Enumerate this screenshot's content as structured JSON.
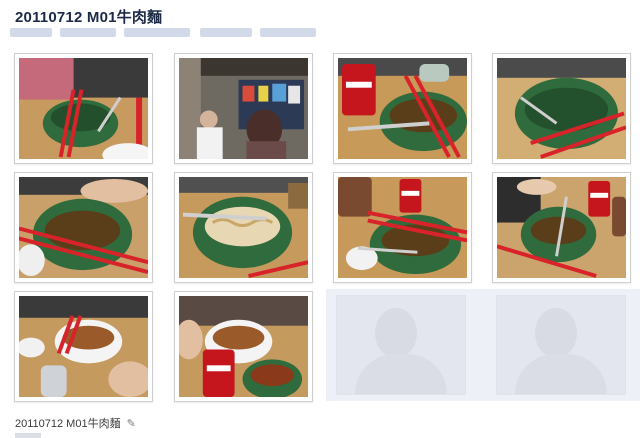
{
  "album": {
    "title": "20110712 M01牛肉麵"
  },
  "photos": [
    {
      "name": "photo-1",
      "alt": "bowl with chopsticks"
    },
    {
      "name": "photo-2",
      "alt": "restaurant interior"
    },
    {
      "name": "photo-3",
      "alt": "coca-cola and bowl"
    },
    {
      "name": "photo-4",
      "alt": "empty bowl"
    },
    {
      "name": "photo-5",
      "alt": "bowl with chopsticks"
    },
    {
      "name": "photo-6",
      "alt": "noodle bowl"
    },
    {
      "name": "photo-7",
      "alt": "bowl and cola can"
    },
    {
      "name": "photo-8",
      "alt": "bowl with spoon"
    },
    {
      "name": "photo-9",
      "alt": "soup bowl"
    },
    {
      "name": "photo-10",
      "alt": "cola and soup"
    }
  ],
  "caption": {
    "text": "20110712 M01牛肉麵",
    "edit_icon": "pencil-icon"
  },
  "colors": {
    "title": "#1c2a47",
    "bowl": "#2f6b3c",
    "chopstick": "#d8232a",
    "table": "#c89a5a"
  }
}
